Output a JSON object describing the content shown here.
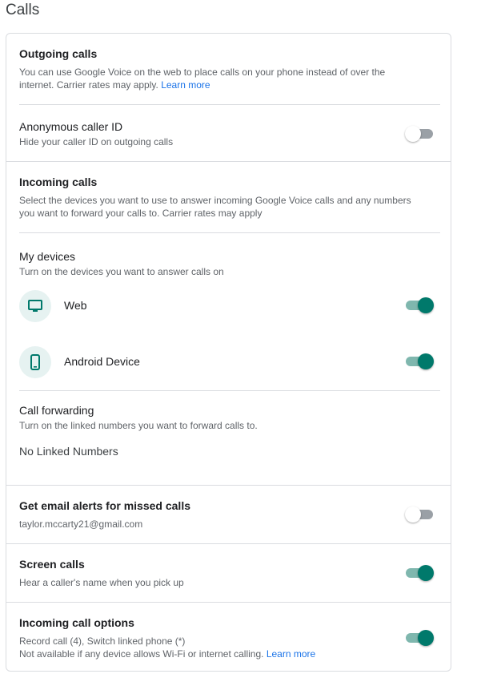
{
  "page_title": "Calls",
  "outgoing": {
    "title": "Outgoing calls",
    "desc_line1": "You can use Google Voice on the web to place calls on your phone instead of over the",
    "desc_line2": "internet. Carrier rates may apply.",
    "learn_more": "Learn more"
  },
  "anonymous": {
    "title": "Anonymous caller ID",
    "desc": "Hide your caller ID on outgoing calls",
    "enabled": false
  },
  "incoming": {
    "title": "Incoming calls",
    "desc_line1": "Select the devices you want to use to answer incoming Google Voice calls and any numbers",
    "desc_line2": "you want to forward your calls to. Carrier rates may apply"
  },
  "devices": {
    "title": "My devices",
    "desc": "Turn on the devices you want to answer calls on",
    "items": [
      {
        "label": "Web",
        "icon": "monitor-icon",
        "enabled": true
      },
      {
        "label": "Android Device",
        "icon": "phone-icon",
        "enabled": true
      }
    ]
  },
  "forwarding": {
    "title": "Call forwarding",
    "desc": "Turn on the linked numbers you want to forward calls to.",
    "empty": "No Linked Numbers"
  },
  "email_alerts": {
    "title": "Get email alerts for missed calls",
    "email": "taylor.mccarty21@gmail.com",
    "enabled": false
  },
  "screen": {
    "title": "Screen calls",
    "desc": "Hear a caller's name when you pick up",
    "enabled": true
  },
  "options": {
    "title": "Incoming call options",
    "desc_line1": "Record call (4), Switch linked phone (*)",
    "desc_line2": "Not available if any device allows Wi-Fi or internet calling.",
    "learn_more": "Learn more",
    "enabled": true
  },
  "colors": {
    "accent": "#00796b",
    "accent_track": "#7fb7ae",
    "link": "#1a73e8",
    "device_bg": "#e6f2f1"
  }
}
